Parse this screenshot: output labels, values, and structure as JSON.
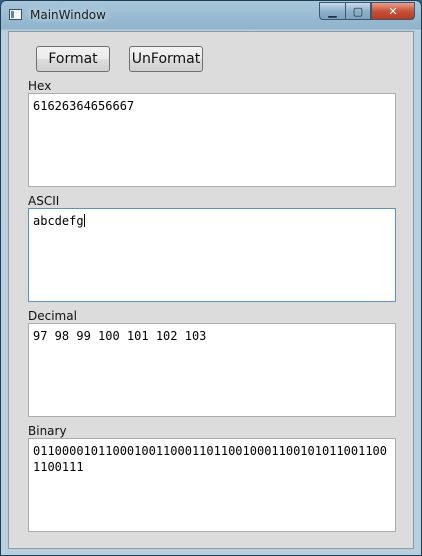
{
  "window": {
    "title": "MainWindow",
    "caption": {
      "minimize": "▁",
      "maximize": "▢",
      "close": "✕"
    }
  },
  "toolbar": {
    "format_label": "Format",
    "unformat_label": "UnFormat"
  },
  "fields": {
    "hex": {
      "label": "Hex",
      "value": "61626364656667"
    },
    "ascii": {
      "label": "ASCII",
      "value": "abcdefg"
    },
    "decimal": {
      "label": "Decimal",
      "value": "97 98 99 100 101 102 103"
    },
    "binary": {
      "label": "Binary",
      "value": "01100001011000100110001101100100011001010110011001100111"
    }
  }
}
